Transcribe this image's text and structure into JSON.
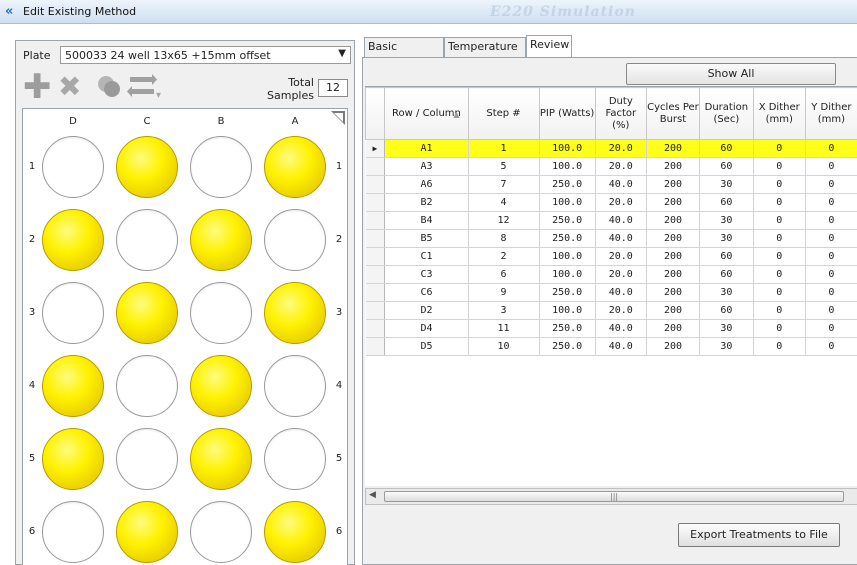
{
  "window": {
    "title": "Edit Existing Method",
    "background_title": "E220 Simulation",
    "app_icon": "app-logo-icon"
  },
  "plate": {
    "label": "Plate",
    "selected": "500033 24 well 13x65 +15mm offset",
    "total_label": "Total Samples",
    "total_value": "12",
    "columns": [
      "D",
      "C",
      "B",
      "A"
    ],
    "rows": [
      "1",
      "2",
      "3",
      "4",
      "5",
      "6"
    ],
    "wells_filled": [
      [
        false,
        true,
        false,
        true
      ],
      [
        true,
        false,
        true,
        false
      ],
      [
        false,
        true,
        false,
        true
      ],
      [
        true,
        false,
        true,
        false
      ],
      [
        true,
        false,
        true,
        false
      ],
      [
        false,
        true,
        false,
        true
      ]
    ],
    "filled_color": "#fff200",
    "toolbar_icons": [
      "add-icon",
      "delete-icon",
      "copy-icon",
      "swap-icon",
      "dropdown-arrow-icon"
    ]
  },
  "tabs": [
    "Basic Settings",
    "Temperature",
    "Review"
  ],
  "active_tab": "Review",
  "review": {
    "show_all": "Show All",
    "export": "Export Treatments to File",
    "headers": [
      "Row / Column",
      "Step #",
      "PIP (Watts)",
      "Duty Factor (%)",
      "Cycles Per Burst",
      "Duration (Sec)",
      "X Dither (mm)",
      "Y Dither (mm)"
    ],
    "selected_row_color": "#ffff1a",
    "rows": [
      [
        "A1",
        "1",
        "100.0",
        "20.0",
        "200",
        "60",
        "0",
        "0"
      ],
      [
        "A3",
        "5",
        "100.0",
        "20.0",
        "200",
        "60",
        "0",
        "0"
      ],
      [
        "A6",
        "7",
        "250.0",
        "40.0",
        "200",
        "30",
        "0",
        "0"
      ],
      [
        "B2",
        "4",
        "100.0",
        "20.0",
        "200",
        "60",
        "0",
        "0"
      ],
      [
        "B4",
        "12",
        "250.0",
        "40.0",
        "200",
        "30",
        "0",
        "0"
      ],
      [
        "B5",
        "8",
        "250.0",
        "40.0",
        "200",
        "30",
        "0",
        "0"
      ],
      [
        "C1",
        "2",
        "100.0",
        "20.0",
        "200",
        "60",
        "0",
        "0"
      ],
      [
        "C3",
        "6",
        "100.0",
        "20.0",
        "200",
        "60",
        "0",
        "0"
      ],
      [
        "C6",
        "9",
        "250.0",
        "40.0",
        "200",
        "30",
        "0",
        "0"
      ],
      [
        "D2",
        "3",
        "100.0",
        "20.0",
        "200",
        "60",
        "0",
        "0"
      ],
      [
        "D4",
        "11",
        "250.0",
        "40.0",
        "200",
        "30",
        "0",
        "0"
      ],
      [
        "D5",
        "10",
        "250.0",
        "40.0",
        "200",
        "30",
        "0",
        "0"
      ]
    ]
  }
}
